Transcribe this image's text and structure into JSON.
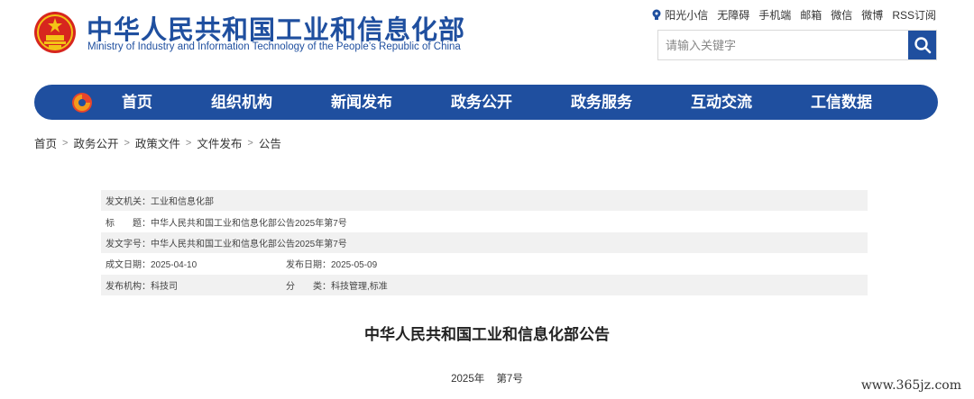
{
  "header": {
    "title": "中华人民共和国工业和信息化部",
    "subtitle": "Ministry of Industry and Information Technology of the People’s Republic of China",
    "toplinks": [
      "阳光小信",
      "无障碍",
      "手机端",
      "邮箱",
      "微信",
      "微博",
      "RSS订阅"
    ],
    "search_placeholder": "请输入关键字"
  },
  "nav": {
    "items": [
      "首页",
      "组织机构",
      "新闻发布",
      "政务公开",
      "政务服务",
      "互动交流",
      "工信数据"
    ]
  },
  "breadcrumb": [
    "首页",
    "政务公开",
    "政策文件",
    "文件发布",
    "公告"
  ],
  "meta": {
    "issuer": "发文机关：工业和信息化部",
    "title": "标　　题：中华人民共和国工业和信息化部公告2025年第7号",
    "doc_no": "发文字号：中华人民共和国工业和信息化部公告2025年第7号",
    "written_date": "成文日期：2025-04-10",
    "publish_date": "发布日期：2025-05-09",
    "org": "发布机构：科技司",
    "category": "分　　类：科技管理,标准"
  },
  "document": {
    "title": "中华人民共和国工业和信息化部公告",
    "year": "2025年",
    "number": "第7号"
  },
  "watermark": "www.365jz.com",
  "colors": {
    "brand": "#1f4f9f",
    "emblem_red": "#d7261e",
    "emblem_gold": "#f3c316"
  }
}
